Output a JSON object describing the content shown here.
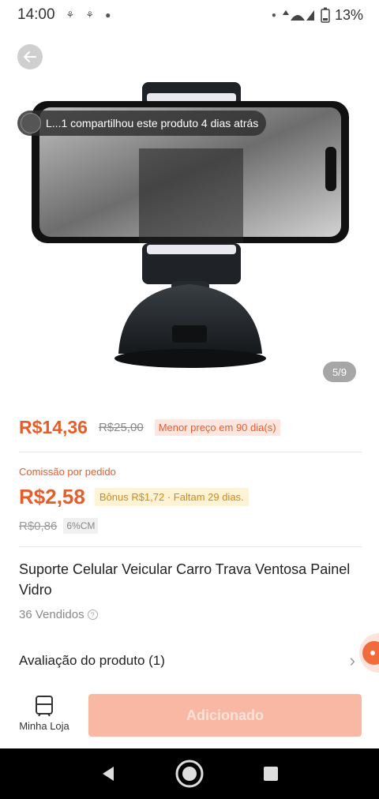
{
  "status_bar": {
    "time": "14:00",
    "battery": "13%",
    "icons": [
      "signal-icon",
      "wifi-icon",
      "battery-icon"
    ]
  },
  "product": {
    "share_notice": "L...1 compartilhou este produto 4 dias atrás",
    "image_counter": "5/9",
    "price": "R$14,36",
    "old_price": "R$25,00",
    "price_tag": "Menor preço em 90 dia(s)",
    "commission_label": "Comissão por pedido",
    "commission_value": "R$2,58",
    "bonus_text": "Bônus R$1,72 · Faltam 29 dias.",
    "commission_old": "R$0,86",
    "commission_rate": "6%CM",
    "title": "Suporte Celular Veicular Carro Trava Ventosa Painel Vidro",
    "sold": "36 Vendidos",
    "reviews": "Avaliação do produto (1)"
  },
  "action_bar": {
    "store_label": "Minha Loja",
    "add_label": "Adicionado"
  },
  "colors": {
    "accent": "#e85c2a",
    "add_button": "#f9b8a4"
  }
}
